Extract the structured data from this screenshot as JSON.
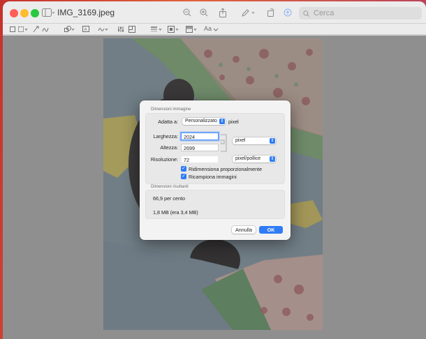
{
  "window": {
    "title": "IMG_3169.jpeg",
    "search_placeholder": "Cerca"
  },
  "toolbar": {
    "text_style_label": "Aa"
  },
  "dialog": {
    "section1_label": "Dimensioni immagine",
    "fit_label": "Adatta a:",
    "fit_value": "Personalizzato",
    "fit_unit": "pixel",
    "width_label": "Larghezza:",
    "width_value": "2024",
    "height_label": "Altezza:",
    "height_value": "2699",
    "size_unit_value": "pixel",
    "resolution_label": "Risoluzione:",
    "resolution_value": "72",
    "resolution_unit_value": "pixel/pollice",
    "scale_proportionally_label": "Ridimensiona proporzionalmente",
    "resample_label": "Ricampiona immagini",
    "section2_label": "Dimensioni risultanti",
    "result_percent": "66,9 per cento",
    "result_size": "1,8 MB (era 3,4 MB)",
    "cancel_label": "Annulla",
    "ok_label": "OK"
  },
  "colors": {
    "accent": "#2f7cf6",
    "close": "#ff5f57",
    "minimize": "#febc2e",
    "zoom": "#28c840"
  },
  "icons": [
    "sidebar-icon",
    "zoom-out-icon",
    "zoom-in-icon",
    "share-icon",
    "markup-pen-icon",
    "rotate-icon",
    "markup-toolbar-icon",
    "search-icon",
    "text-selection-icon",
    "rect-selection-icon",
    "instant-alpha-icon",
    "sketch-icon",
    "shapes-icon",
    "text-box-icon",
    "sign-icon",
    "adjust-color-icon",
    "adjust-size-icon",
    "shape-style-icon",
    "border-color-icon",
    "fill-color-icon"
  ]
}
